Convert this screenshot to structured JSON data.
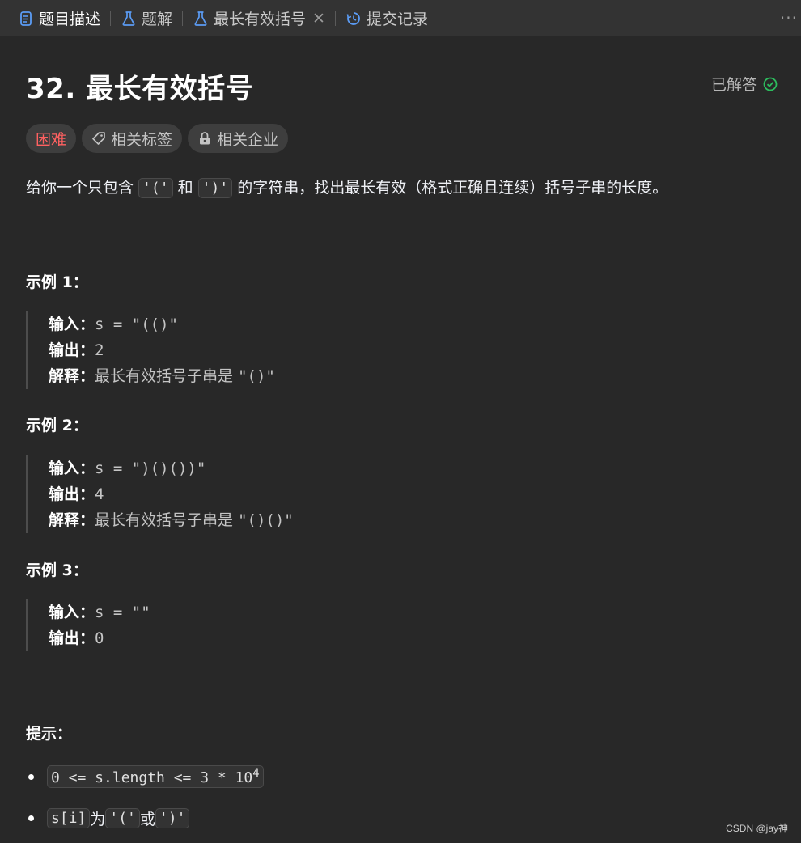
{
  "tabs": [
    {
      "label": "题目描述",
      "icon": "document-icon",
      "active": true
    },
    {
      "label": "题解",
      "icon": "flask-icon",
      "active": false
    },
    {
      "label": "最长有效括号",
      "icon": "flask-icon",
      "active": false,
      "closable": true
    },
    {
      "label": "提交记录",
      "icon": "history-icon",
      "active": false
    }
  ],
  "more_label": "···",
  "problem": {
    "title": "32. 最长有效括号",
    "status": "已解答",
    "difficulty": "困难",
    "tag_related": "相关标签",
    "tag_company": "相关企业",
    "desc_pre": "给你一个只包含 ",
    "desc_code1": "'('",
    "desc_mid": " 和 ",
    "desc_code2": "')'",
    "desc_post": " 的字符串，找出最长有效（格式正确且连续）括号子串的长度。"
  },
  "examples": [
    {
      "title": "示例 1：",
      "input_label": "输入：",
      "input": "s = \"(()\"",
      "output_label": "输出：",
      "output": "2",
      "explain_label": "解释：",
      "explain_text": "最长有效括号子串是 ",
      "explain_code": "\"()\""
    },
    {
      "title": "示例 2：",
      "input_label": "输入：",
      "input": "s = \")()())\"",
      "output_label": "输出：",
      "output": "4",
      "explain_label": "解释：",
      "explain_text": "最长有效括号子串是 ",
      "explain_code": "\"()()\""
    },
    {
      "title": "示例 3：",
      "input_label": "输入：",
      "input": "s = \"\"",
      "output_label": "输出：",
      "output": "0"
    }
  ],
  "hints": {
    "title": "提示：",
    "h1_code": "0 <= s.length <= 3 * 10",
    "h1_sup": "4",
    "h2_code1": "s[i]",
    "h2_mid1": " 为 ",
    "h2_code2": "'('",
    "h2_mid2": " 或 ",
    "h2_code3": "')'"
  },
  "watermark": "CSDN @jay神",
  "colors": {
    "hard": "#ff6161",
    "solved_check": "#2cbb5d",
    "tab_icon_active": "#5b9cf5"
  }
}
